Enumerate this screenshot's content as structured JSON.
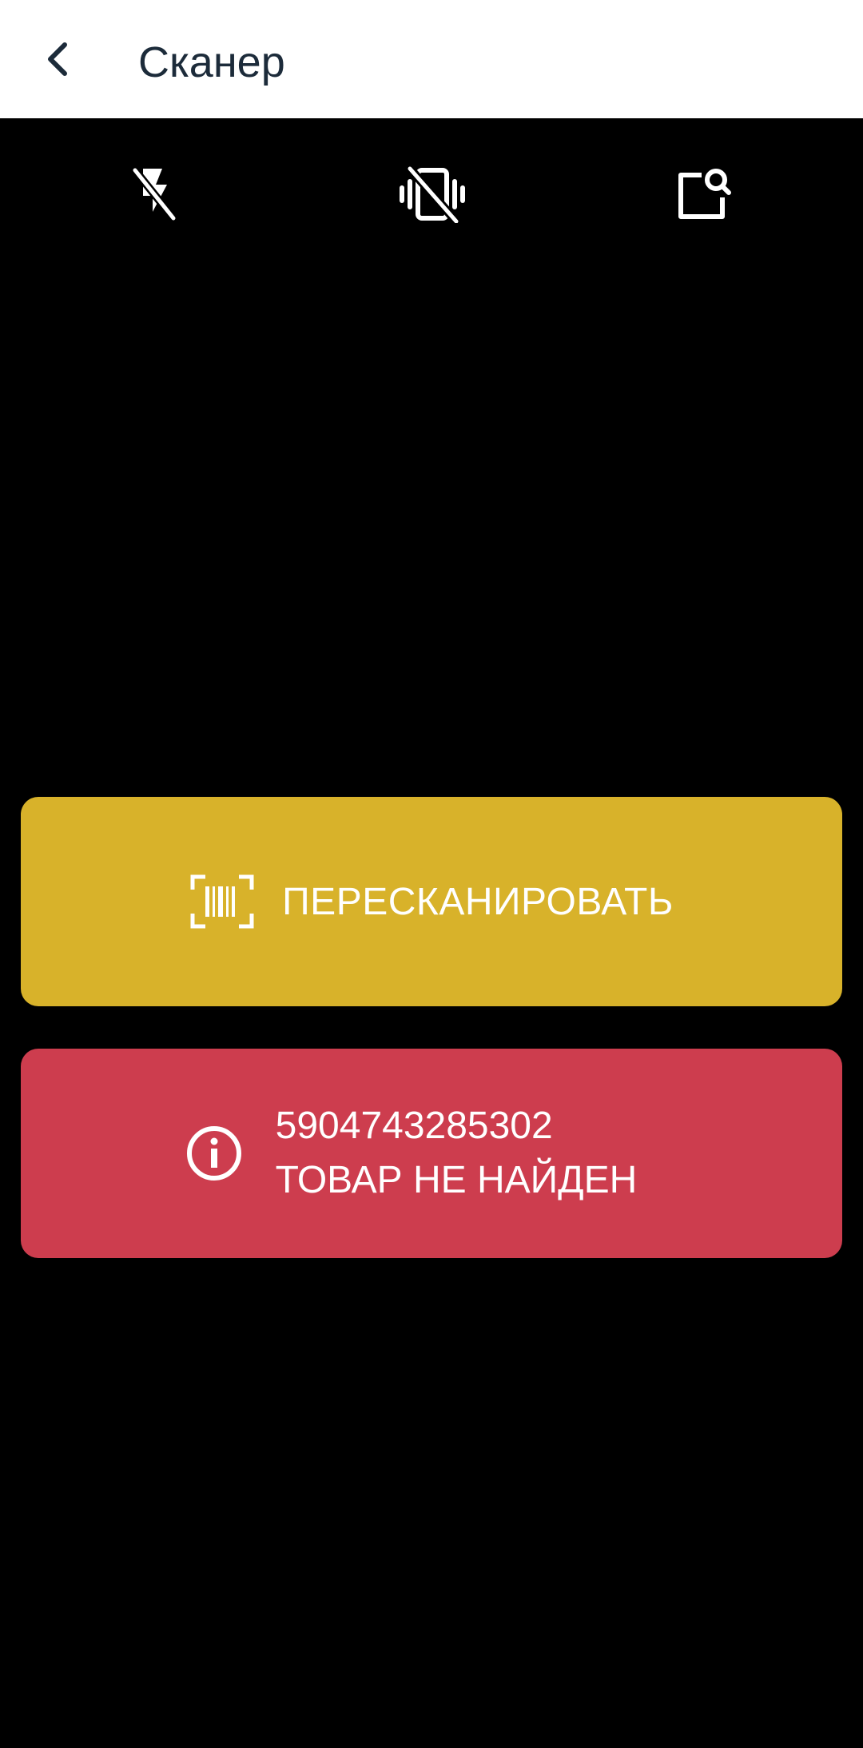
{
  "header": {
    "title": "Сканер",
    "back_icon": "chevron-left-icon"
  },
  "toolbar": {
    "items": [
      {
        "icon": "flash-off-icon"
      },
      {
        "icon": "vibration-off-icon"
      },
      {
        "icon": "search-image-icon"
      }
    ]
  },
  "rescan": {
    "label": "ПЕРЕСКАНИРОВАТЬ",
    "icon": "barcode-scan-icon",
    "color": "#d8b22a"
  },
  "result": {
    "code": "5904743285302",
    "message": "ТОВАР НЕ НАЙДЕН",
    "icon": "info-icon",
    "color": "#cd3d4e"
  },
  "colors": {
    "header_bg": "#ffffff",
    "title_text": "#1c2b3a",
    "camera_bg": "#000000"
  }
}
